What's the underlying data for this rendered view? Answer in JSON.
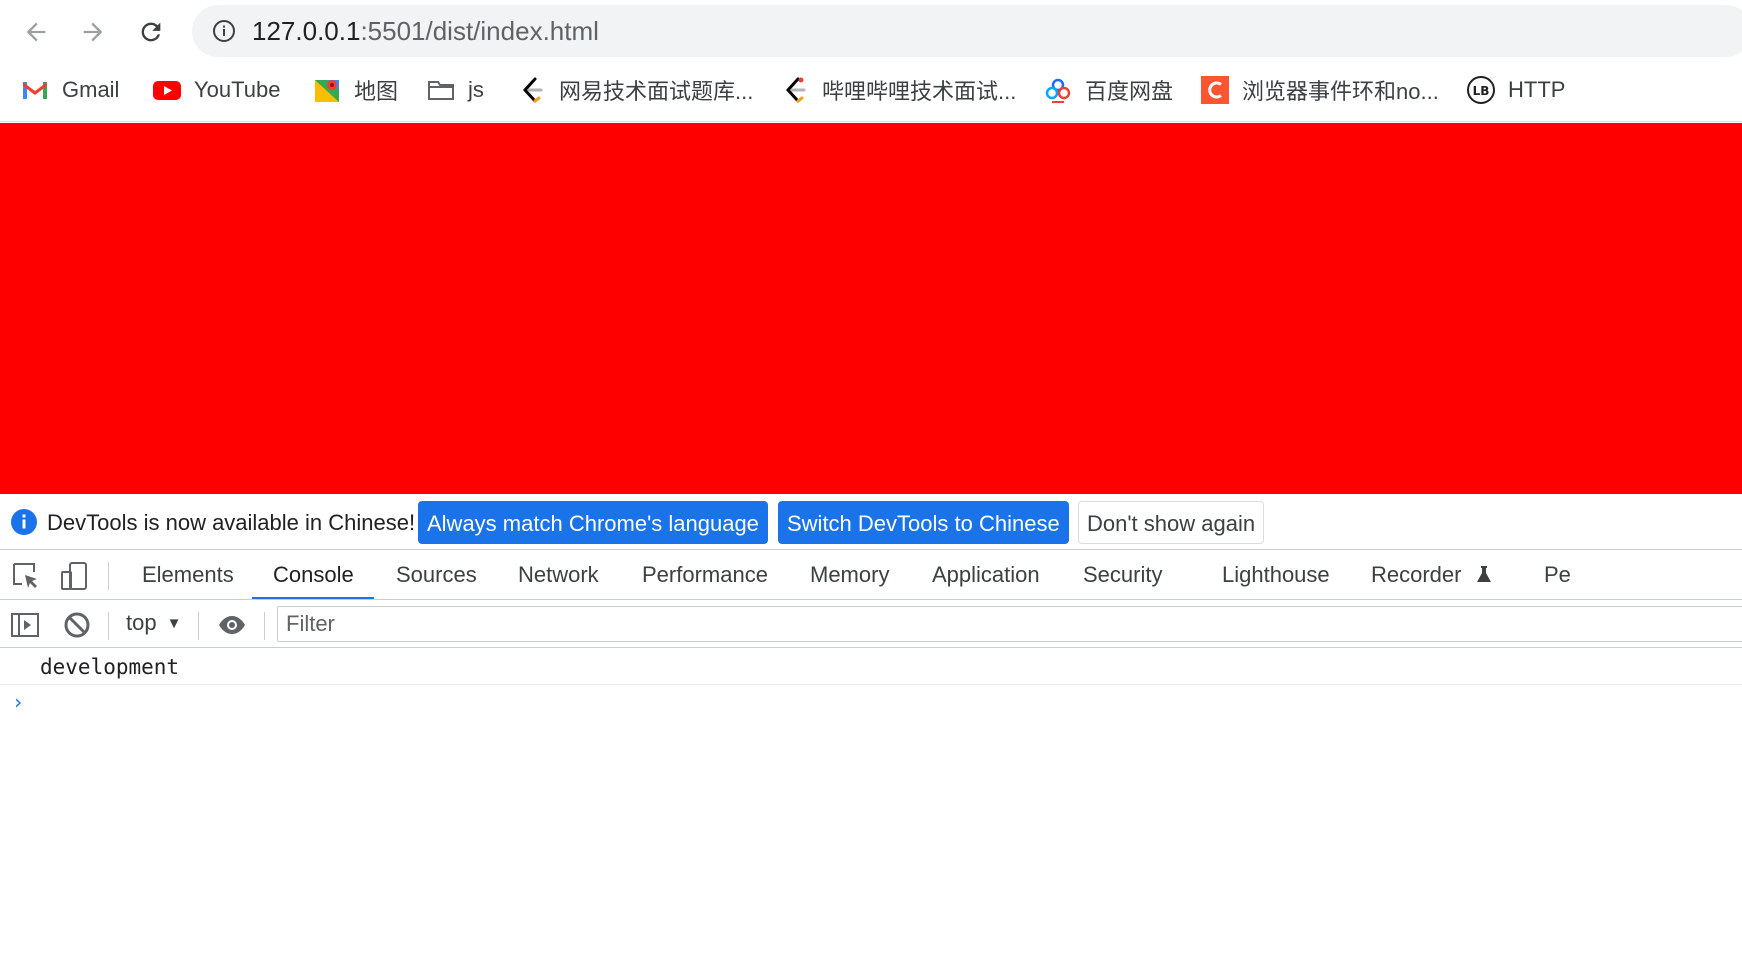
{
  "address_bar": {
    "url_host": "127.0.0.1",
    "url_path": ":5501/dist/index.html"
  },
  "bookmarks": [
    {
      "label": "Gmail",
      "icon": "gmail-icon"
    },
    {
      "label": "YouTube",
      "icon": "youtube-icon"
    },
    {
      "label": "地图",
      "icon": "maps-icon"
    },
    {
      "label": "js",
      "icon": "folder-icon"
    },
    {
      "label": "网易技术面试题库...",
      "icon": "leetcode-icon"
    },
    {
      "label": "哔哩哔哩技术面试...",
      "icon": "leetcode-icon"
    },
    {
      "label": "百度网盘",
      "icon": "baidu-netdisk-icon"
    },
    {
      "label": "浏览器事件环和no...",
      "icon": "csdn-icon"
    },
    {
      "label": "HTTP",
      "icon": "lb-icon"
    }
  ],
  "page": {
    "background": "#ff0000"
  },
  "infobar": {
    "message": "DevTools is now available in Chinese!",
    "btn_match": "Always match Chrome's language",
    "btn_switch": "Switch DevTools to Chinese",
    "btn_dismiss": "Don't show again"
  },
  "devtools": {
    "tabs": [
      "Elements",
      "Console",
      "Sources",
      "Network",
      "Performance",
      "Memory",
      "Application",
      "Security",
      "Lighthouse",
      "Recorder",
      "Pe"
    ],
    "active_tab": "Console"
  },
  "console": {
    "context": "top",
    "filter_placeholder": "Filter",
    "messages": [
      "development"
    ],
    "prompt": "›"
  },
  "colors": {
    "accent": "#1a73e8",
    "page_red": "#ff0000"
  }
}
